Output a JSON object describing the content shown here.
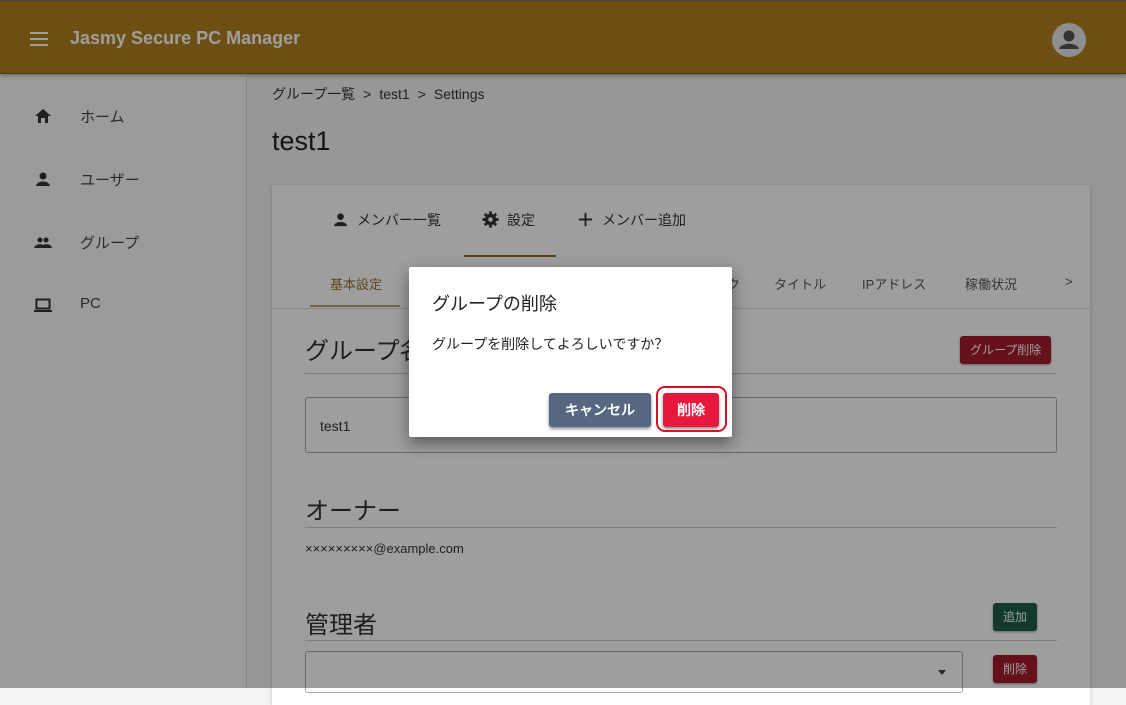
{
  "appbar": {
    "title": "Jasmy Secure PC Manager"
  },
  "sidebar": {
    "items": [
      {
        "label": "ホーム",
        "icon": "home-icon"
      },
      {
        "label": "ユーザー",
        "icon": "person-icon"
      },
      {
        "label": "グループ",
        "icon": "group-icon"
      },
      {
        "label": "PC",
        "icon": "laptop-icon"
      }
    ]
  },
  "breadcrumb": {
    "items": [
      "グループ一覧",
      "test1",
      "Settings"
    ],
    "separator": ">"
  },
  "page": {
    "title": "test1"
  },
  "tabs": {
    "top": [
      {
        "label": "メンバー一覧",
        "icon": "person-icon"
      },
      {
        "label": "設定",
        "icon": "gear-icon"
      },
      {
        "label": "メンバー追加",
        "icon": "plus-icon"
      }
    ],
    "sub": [
      "基本設定",
      "タイトル",
      "IPアドレス",
      "稼働状況"
    ],
    "sub_partial": "ク",
    "sub_more": ">"
  },
  "sections": {
    "group_name": {
      "title_fragment": "グループ名",
      "delete_button": "グループ削除",
      "value": "test1"
    },
    "owner": {
      "title": "オーナー",
      "email": "×××××××××@example.com"
    },
    "admins": {
      "title": "管理者",
      "add_button": "追加",
      "delete_button": "削除"
    }
  },
  "dialog": {
    "title": "グループの削除",
    "message": "グループを削除してよろしいですか？",
    "cancel": "キャンセル",
    "confirm": "削除"
  },
  "colors": {
    "appbar": "#b07e20",
    "danger": "#a41b2b",
    "success": "#1f5f48",
    "dialog_confirm": "#e8173e",
    "dialog_cancel": "#56677f",
    "highlight": "#d41222"
  }
}
